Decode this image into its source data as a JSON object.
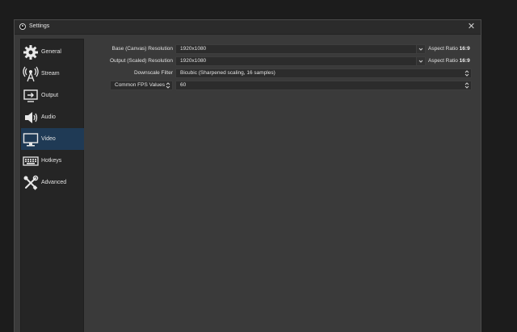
{
  "window": {
    "title": "Settings",
    "close_glyph": "✕"
  },
  "sidebar": {
    "items": [
      {
        "label": "General",
        "icon": "gear-icon"
      },
      {
        "label": "Stream",
        "icon": "broadcast-antenna-icon"
      },
      {
        "label": "Output",
        "icon": "output-icon"
      },
      {
        "label": "Audio",
        "icon": "speaker-icon"
      },
      {
        "label": "Video",
        "icon": "monitor-icon",
        "active": true
      },
      {
        "label": "Hotkeys",
        "icon": "keyboard-icon"
      },
      {
        "label": "Advanced",
        "icon": "tools-icon"
      }
    ]
  },
  "video": {
    "base_label": "Base (Canvas) Resolution",
    "base_value": "1920x1080",
    "base_aspect_prefix": "Aspect Ratio",
    "base_aspect_value": "16:9",
    "output_label": "Output (Scaled) Resolution",
    "output_value": "1920x1080",
    "output_aspect_prefix": "Aspect Ratio",
    "output_aspect_value": "16:9",
    "downscale_label": "Downscale Filter",
    "downscale_value": "Bicubic (Sharpened scaling, 16 samples)",
    "fps_type_value": "Common FPS Values",
    "fps_value": "60"
  },
  "colors": {
    "accent_selected": "#1f3a55",
    "window_bg": "#3a3a3a",
    "sidebar_bg": "#252525",
    "field_bg": "#2c2c2c"
  }
}
